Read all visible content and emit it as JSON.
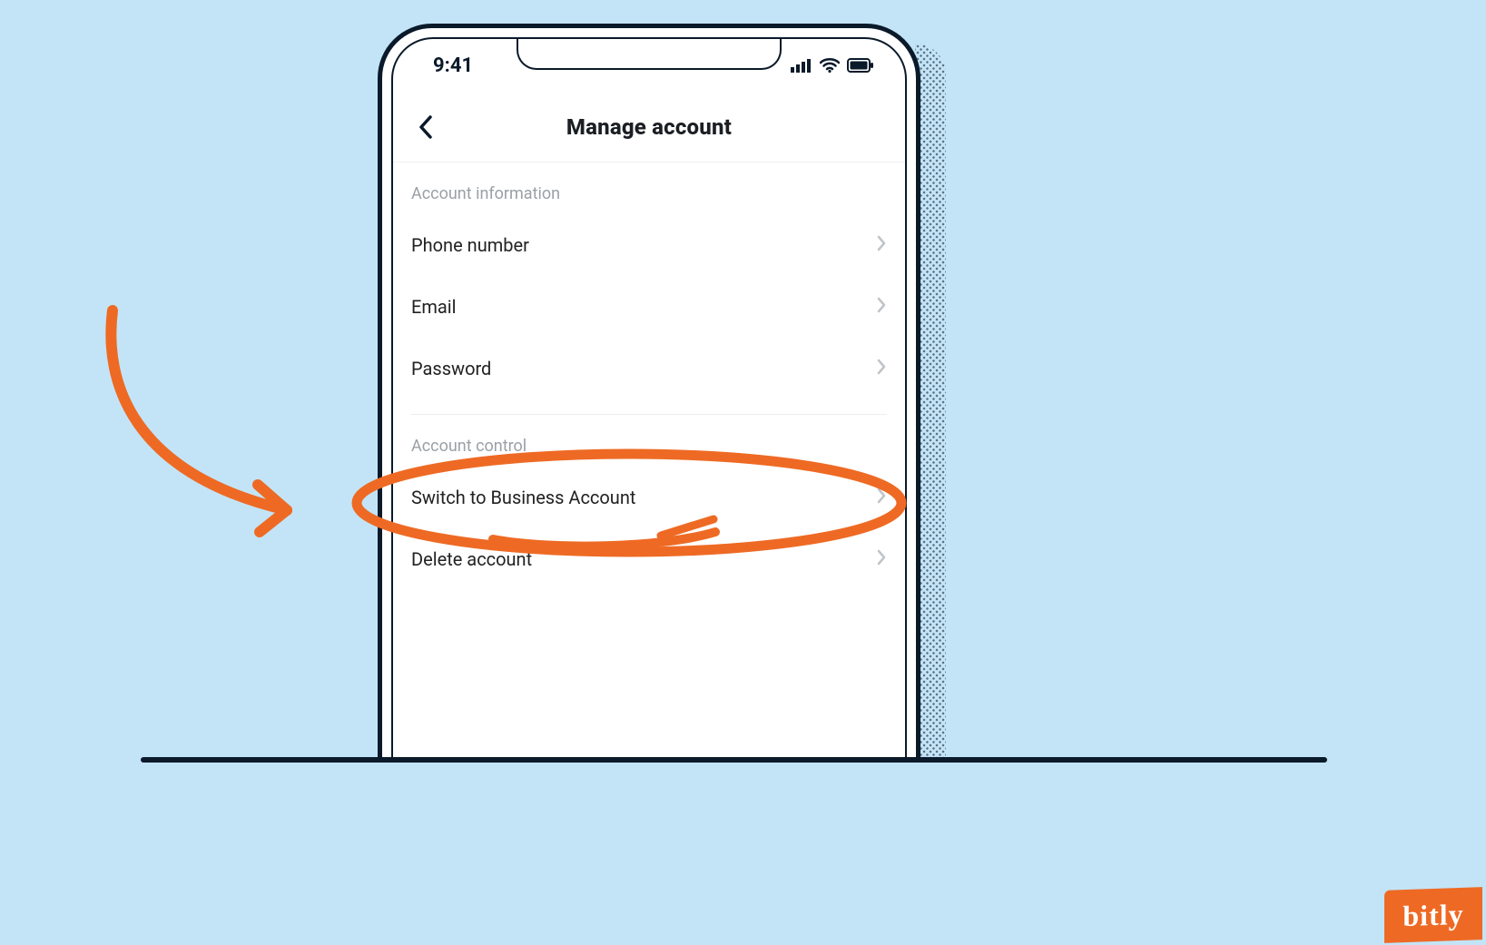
{
  "status": {
    "time": "9:41"
  },
  "nav": {
    "title": "Manage account"
  },
  "sections": {
    "info": {
      "label": "Account information",
      "items": [
        {
          "label": "Phone number"
        },
        {
          "label": "Email"
        },
        {
          "label": "Password"
        }
      ]
    },
    "control": {
      "label": "Account control",
      "items": [
        {
          "label": "Switch to Business Account"
        },
        {
          "label": "Delete account"
        }
      ]
    }
  },
  "annotation": {
    "highlight_target": "Switch to Business Account",
    "color": "#ee6a24"
  },
  "brand": {
    "logo_text": "bitly"
  }
}
